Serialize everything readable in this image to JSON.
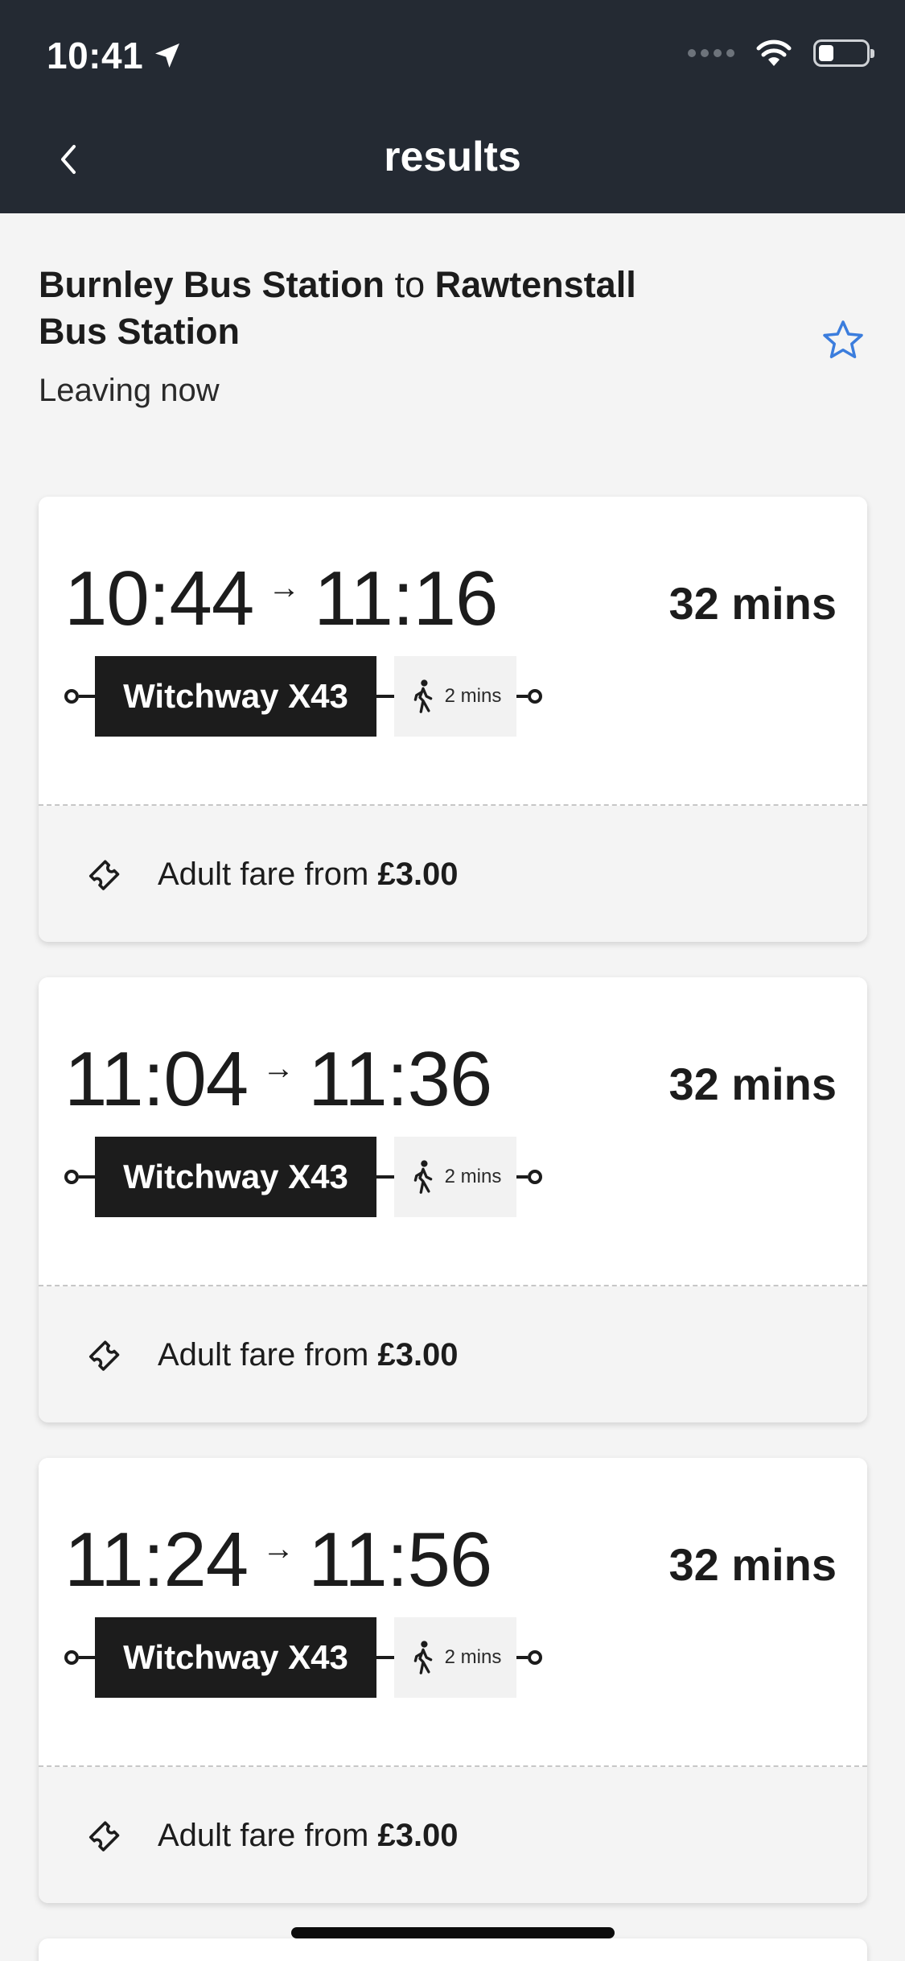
{
  "status_bar": {
    "time": "10:41"
  },
  "nav": {
    "title": "results"
  },
  "route": {
    "origin": "Burnley Bus Station",
    "connector": "to",
    "destination": "Rawtenstall Bus Station",
    "leaving": "Leaving now"
  },
  "journeys": [
    {
      "depart": "10:44",
      "arrive": "11:16",
      "duration": "32 mins",
      "service": "Witchway X43",
      "walk": "2 mins",
      "fare_label": "Adult fare from",
      "fare_price": "£3.00"
    },
    {
      "depart": "11:04",
      "arrive": "11:36",
      "duration": "32 mins",
      "service": "Witchway X43",
      "walk": "2 mins",
      "fare_label": "Adult fare from",
      "fare_price": "£3.00"
    },
    {
      "depart": "11:24",
      "arrive": "11:56",
      "duration": "32 mins",
      "service": "Witchway X43",
      "walk": "2 mins",
      "fare_label": "Adult fare from",
      "fare_price": "£3.00"
    }
  ],
  "colors": {
    "header_bg": "#242a33",
    "accent_star": "#3b7ddd",
    "bus_pill": "#1c1c1c",
    "page_bg": "#f4f4f4"
  }
}
